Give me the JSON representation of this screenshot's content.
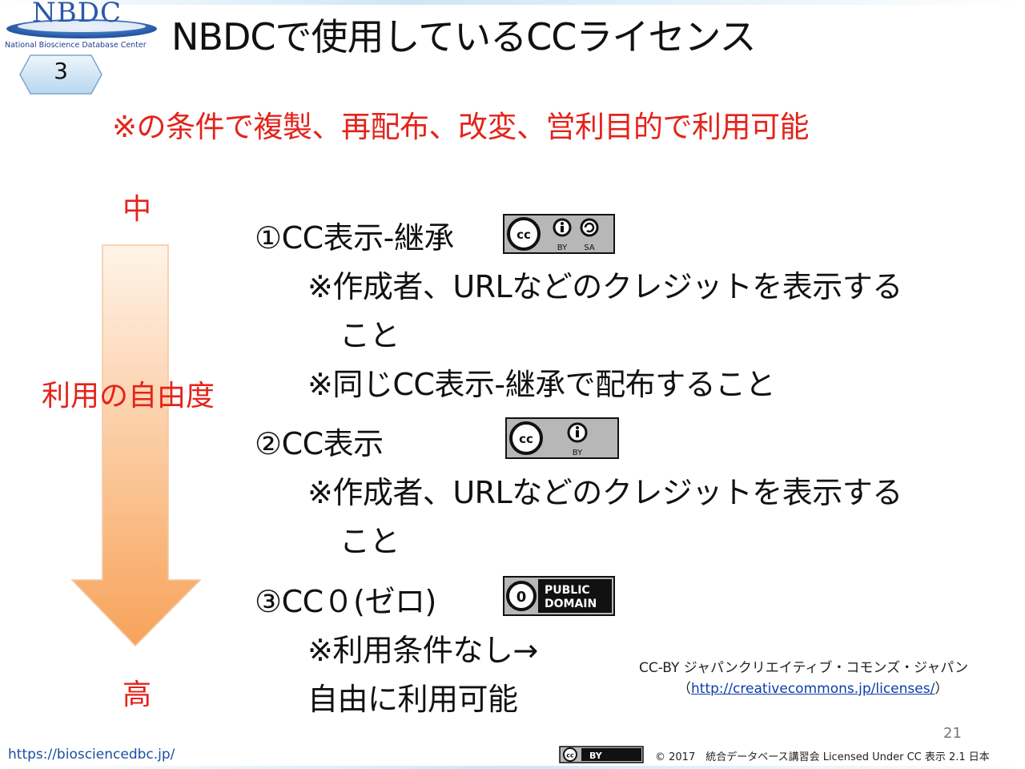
{
  "logo": {
    "name": "NBDC",
    "subtitle": "National Bioscience Database Center"
  },
  "slide_badge": "3",
  "title": "NBDCで使用しているCCライセンス",
  "subtitle": "※の条件で複製、再配布、改変、営利目的で利用可能",
  "axis": {
    "top_label": "中",
    "middle_label": "利用の自由度",
    "bottom_label": "高"
  },
  "licenses": [
    {
      "heading": "①CC表示-継承",
      "badge": {
        "cc": "cc",
        "icons": [
          "BY",
          "SA"
        ]
      },
      "lines": [
        "※作成者、URLなどのクレジットを表示する",
        "こと",
        "※同じCC表示-継承で配布すること"
      ]
    },
    {
      "heading": "②CC表示",
      "badge": {
        "cc": "cc",
        "icons": [
          "BY"
        ]
      },
      "lines": [
        "※作成者、URLなどのクレジットを表示する",
        "こと"
      ]
    },
    {
      "heading": "③CC０(ゼロ)",
      "badge": {
        "line1": "PUBLIC",
        "line2": "DOMAIN"
      },
      "lines": [
        "※利用条件なし→",
        "自由に利用可能"
      ]
    }
  ],
  "credit": {
    "line1": "CC-BY ジャパンクリエイティブ・コモンズ・ジャパン",
    "open_paren": "（",
    "link": "http://creativecommons.jp/licenses/",
    "close_paren": "）"
  },
  "page_number": "21",
  "footer": {
    "url": "https://biosciencedbc.jp/",
    "badge_text": "BY",
    "copyright": "© 2017　統合データベース講習会 Licensed Under CC 表示 2.1 日本"
  },
  "colors": {
    "accent_red": "#e3231b",
    "logo_blue": "#2b58a8",
    "arrow_orange": "#f7a35a"
  }
}
